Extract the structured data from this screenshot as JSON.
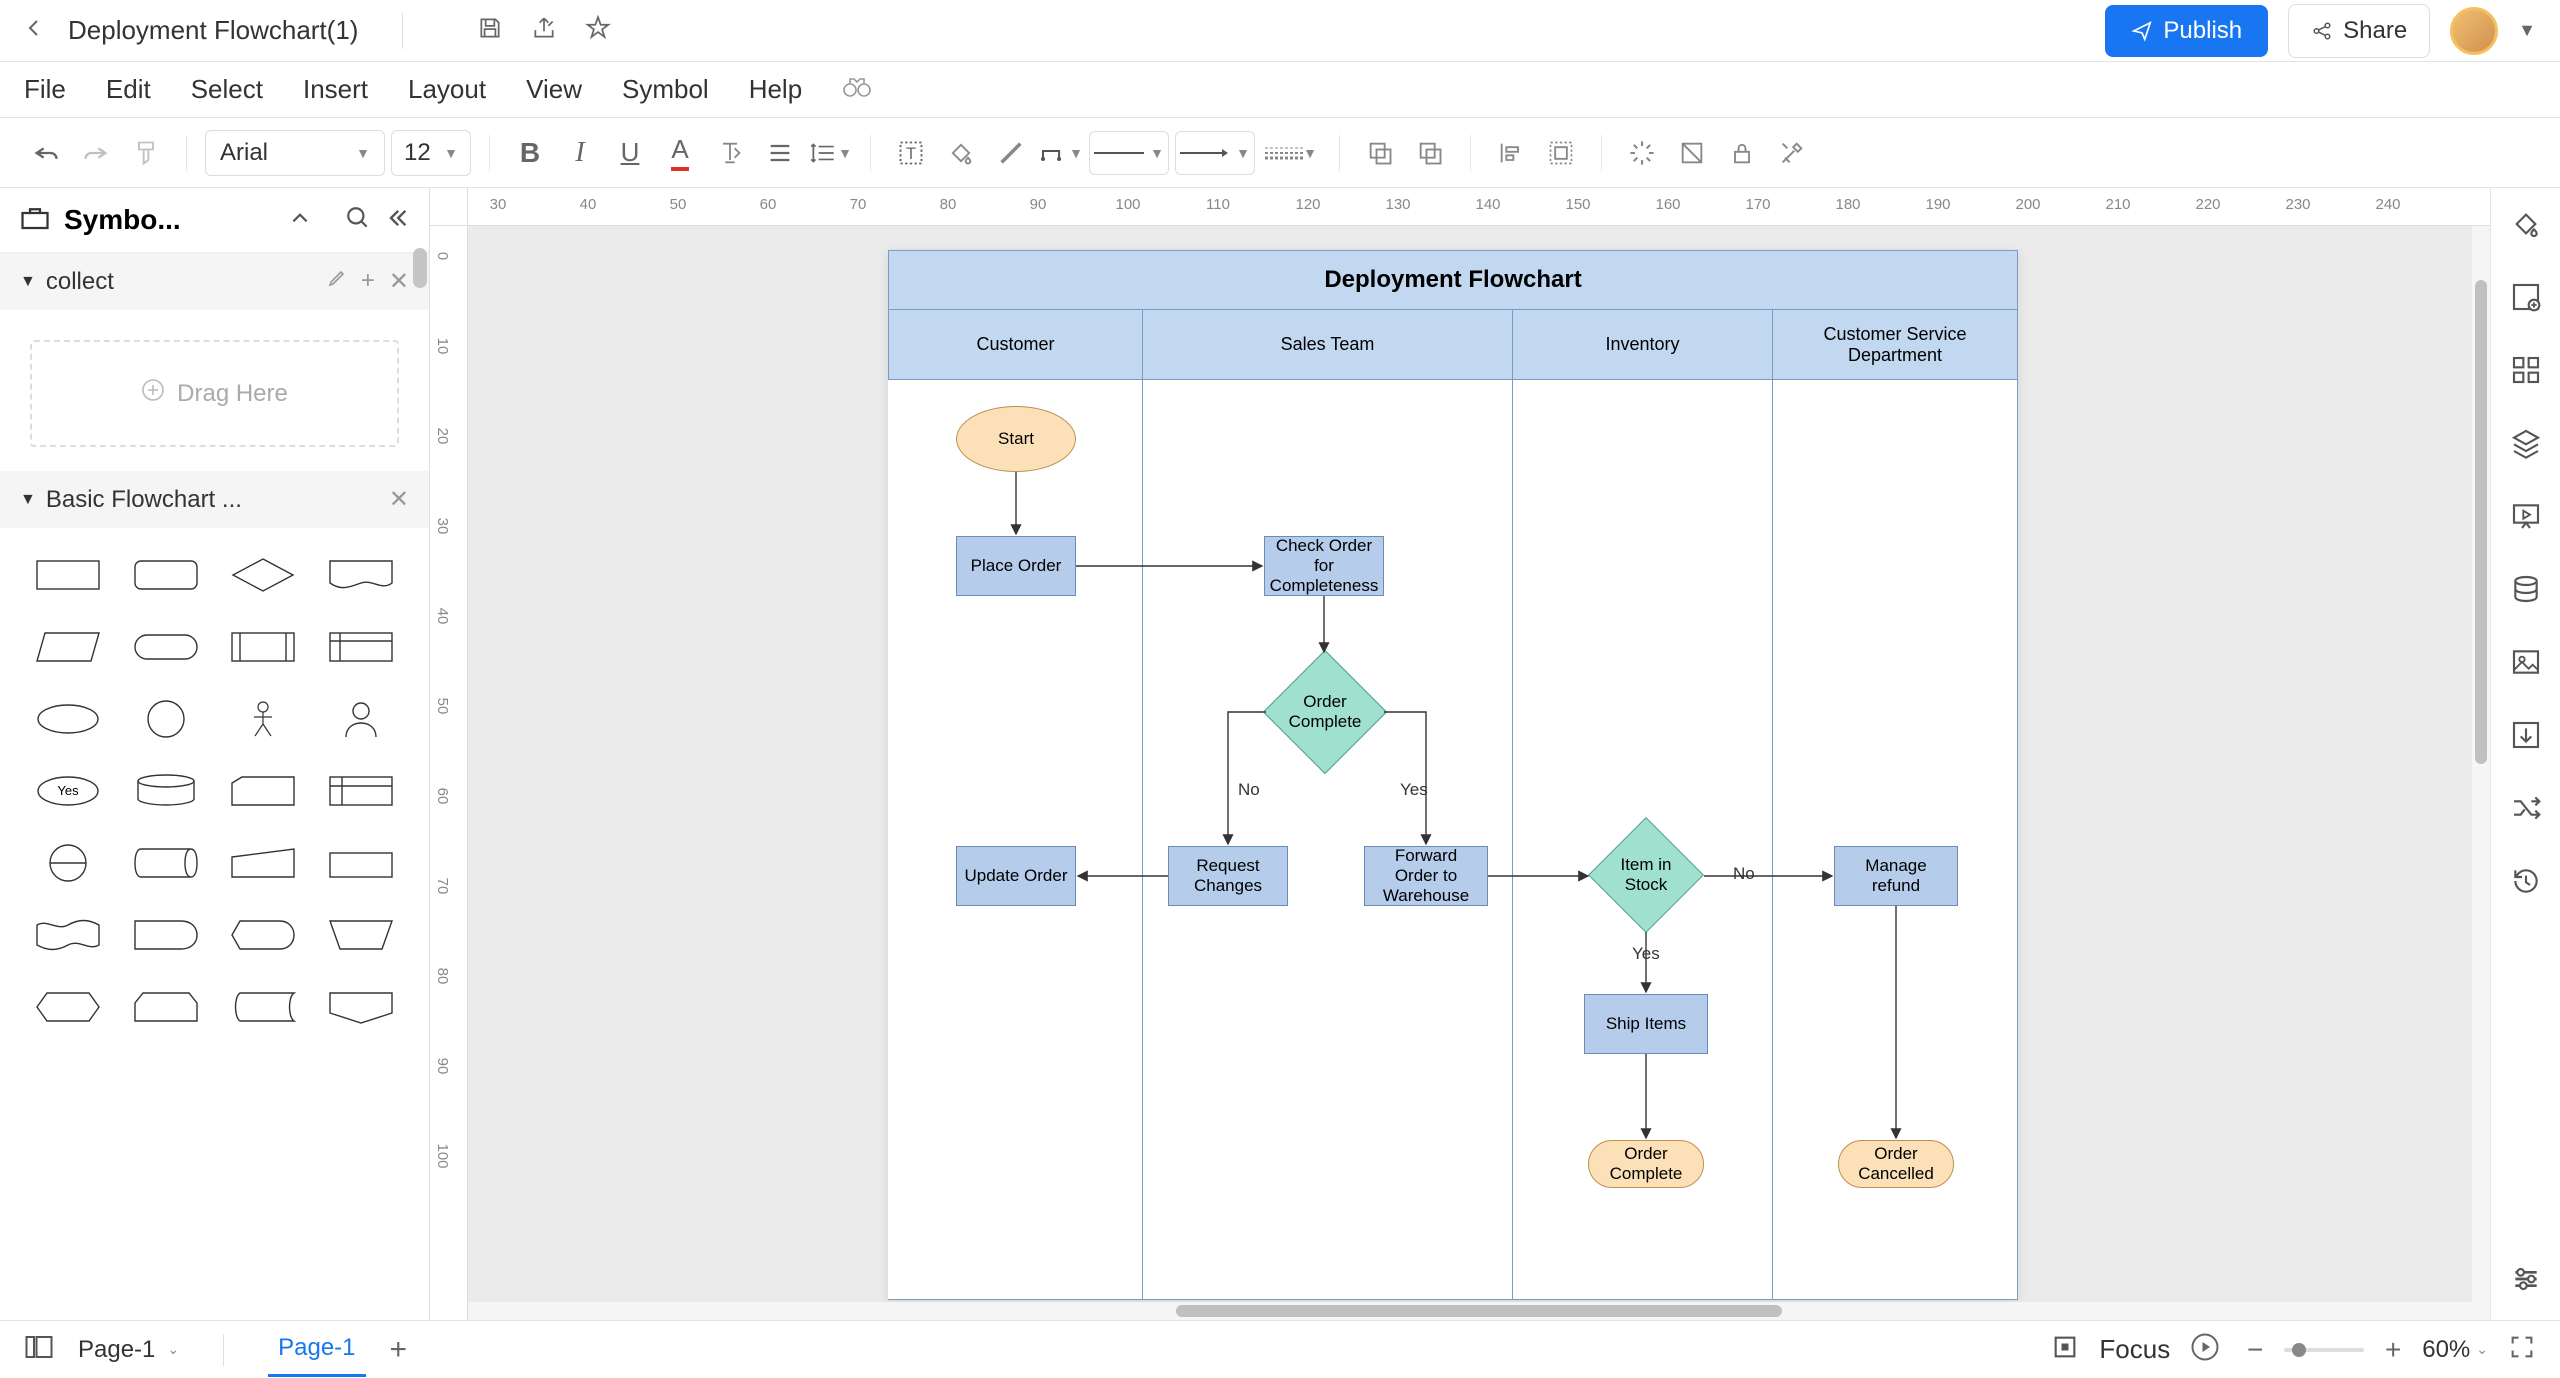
{
  "titlebar": {
    "document_name": "Deployment Flowchart(1)",
    "publish": "Publish",
    "share": "Share"
  },
  "menubar": {
    "file": "File",
    "edit": "Edit",
    "select": "Select",
    "insert": "Insert",
    "layout": "Layout",
    "view": "View",
    "symbol": "Symbol",
    "help": "Help"
  },
  "toolbar": {
    "font": "Arial",
    "size": "12"
  },
  "sidebar": {
    "title": "Symbo...",
    "section_collect": "collect",
    "drag_here": "Drag Here",
    "section_flowchart": "Basic Flowchart ..."
  },
  "flowchart": {
    "title": "Deployment Flowchart",
    "lanes": [
      "Customer",
      "Sales Team",
      "Inventory",
      "Customer Service Department"
    ],
    "nodes": {
      "start": "Start",
      "place_order": "Place Order",
      "check_order": "Check Order for Completeness",
      "order_complete": "Order Complete",
      "update_order": "Update Order",
      "request_changes": "Request Changes",
      "forward_order": "Forward Order to Warehouse",
      "item_in_stock": "Item in Stock",
      "ship_items": "Ship Items",
      "order_complete_end": "Order Complete",
      "manage_refund": "Manage refund",
      "order_cancelled": "Order Cancelled"
    },
    "labels": {
      "no": "No",
      "yes": "Yes"
    }
  },
  "shapes": {
    "yes": "Yes"
  },
  "bottombar": {
    "page_select": "Page-1",
    "page_tab": "Page-1",
    "focus": "Focus",
    "zoom": "60%"
  },
  "ruler_h": [
    "30",
    "40",
    "50",
    "60",
    "70",
    "80",
    "90",
    "100",
    "110",
    "120",
    "130",
    "140",
    "150",
    "160",
    "170",
    "180",
    "190",
    "200",
    "210",
    "220",
    "230",
    "240"
  ],
  "ruler_v": [
    "0",
    "10",
    "20",
    "30",
    "40",
    "50",
    "60",
    "70",
    "80",
    "90",
    "100"
  ]
}
